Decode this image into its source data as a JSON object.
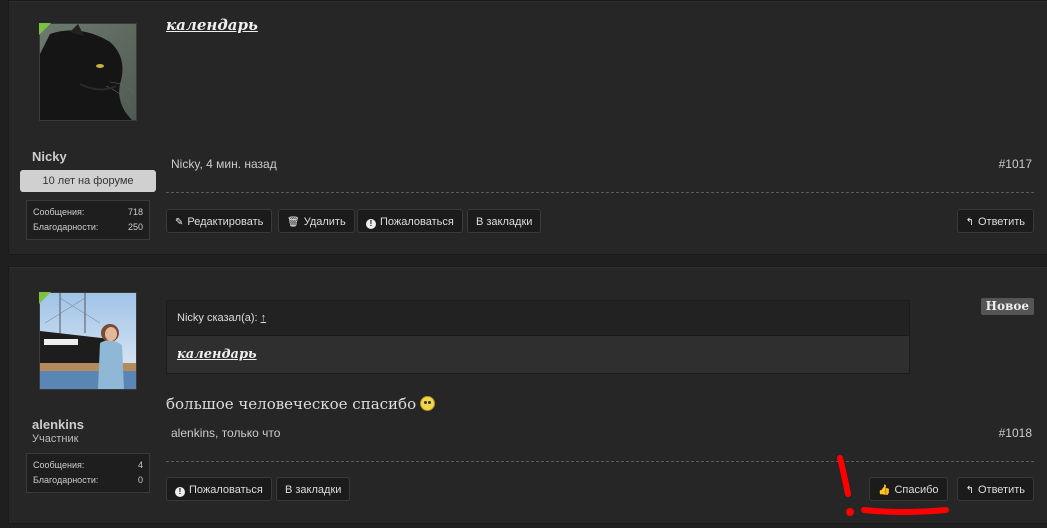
{
  "posts": [
    {
      "title": "календарь",
      "username": "Nicky",
      "badge": "10 лет на форуме",
      "stats": [
        {
          "label": "Сообщения:",
          "value": "718"
        },
        {
          "label": "Благодарности:",
          "value": "250"
        }
      ],
      "meta": "Nicky, 4 мин. назад",
      "number": "#1017",
      "actions": {
        "edit": "Редактировать",
        "delete": "Удалить",
        "report": "Пожаловаться",
        "bookmark": "В закладки",
        "reply": "Ответить"
      }
    },
    {
      "username": "alenkins",
      "usertitle": "Участник",
      "stats": [
        {
          "label": "Сообщения:",
          "value": "4"
        },
        {
          "label": "Благодарности:",
          "value": "0"
        }
      ],
      "quote": {
        "header": "Nicky сказал(а):",
        "arrow": "↑",
        "title": "календарь"
      },
      "new_badge": "Новое",
      "message": "большое человеческое спасибо",
      "meta": "alenkins, только что",
      "number": "#1018",
      "actions": {
        "report": "Пожаловаться",
        "bookmark": "В закладки",
        "thanks": "Спасибо",
        "reply": "Ответить"
      }
    }
  ],
  "colors": {
    "online": "#7cc242",
    "annotation": "#ff0000"
  }
}
